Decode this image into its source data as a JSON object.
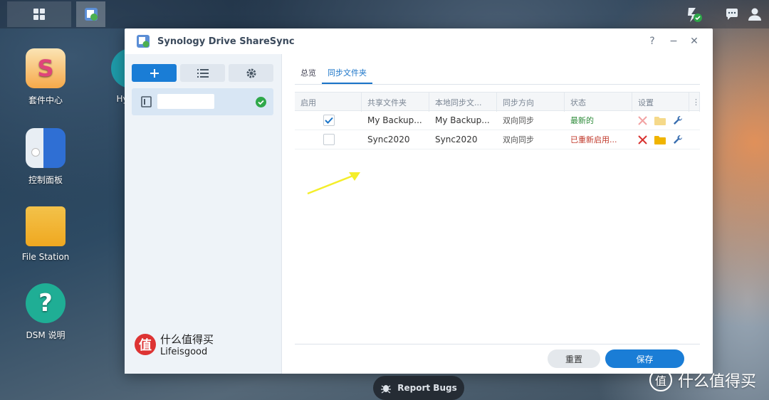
{
  "window": {
    "title": "Synology Drive ShareSync",
    "help": "?",
    "minimize": "−",
    "close": "✕"
  },
  "desktop": {
    "icons": [
      {
        "label": "套件中心"
      },
      {
        "label": "Hype"
      },
      {
        "label": "控制面板"
      },
      {
        "label": "File Station"
      },
      {
        "label": "DSM 说明"
      }
    ]
  },
  "tabs": [
    {
      "label": "总览"
    },
    {
      "label": "同步文件夹"
    }
  ],
  "table": {
    "headers": [
      "启用",
      "共享文件夹",
      "本地同步文...",
      "同步方向",
      "状态",
      "设置",
      "⋮"
    ],
    "rows": [
      {
        "enabled": true,
        "shared": "My Backup...",
        "local": "My Backup...",
        "direction": "双向同步",
        "status": "最新的",
        "status_color": "#2e8b3a"
      },
      {
        "enabled": false,
        "shared": "Sync2020",
        "local": "Sync2020",
        "direction": "双向同步",
        "status": "已重新启用...",
        "status_color": "#c0392b"
      }
    ]
  },
  "buttons": {
    "reset": "重置",
    "save": "保存"
  },
  "watermark": {
    "logo": "值",
    "line1": "什么值得买",
    "line2": "Lifeisgood"
  },
  "report_bugs": "Report Bugs",
  "brand": {
    "logo": "值",
    "text": "什么值得买"
  }
}
